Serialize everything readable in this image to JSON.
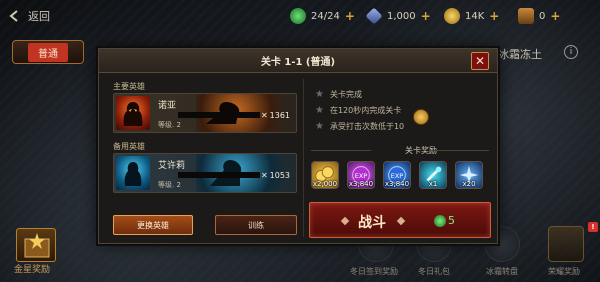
{
  "topbar": {
    "back_label": "返回",
    "resources": [
      {
        "icon": "green-potion-icon",
        "value": "24/24",
        "color": "#3fae4a"
      },
      {
        "icon": "blue-shard-icon",
        "value": "1,000",
        "color": "#6a86c8"
      },
      {
        "icon": "gold-coin-icon",
        "value": "14K",
        "color": "#d4a23c"
      },
      {
        "icon": "chest-icon",
        "value": "0",
        "color": "#b0783a"
      }
    ],
    "plus": "+"
  },
  "background": {
    "tab_label": "普通",
    "right_title": "冰霜冻土",
    "info": "i"
  },
  "dialog": {
    "title": "关卡 1-1 (普通)",
    "close": "✕",
    "main_hero_label": "主要英雄",
    "backup_hero_label": "备用英雄",
    "heroes": [
      {
        "name": "诺亚",
        "level": "等级. 2",
        "power": "1361"
      },
      {
        "name": "艾许莉",
        "level": "等级. 2",
        "power": "1053"
      }
    ],
    "swap_button": "更换英雄",
    "train_button": "训练",
    "objectives": [
      "关卡完成",
      "在120秒内完成关卡",
      "承受打击次数低于10"
    ],
    "reward_title": "关卡奖励",
    "rewards": [
      {
        "icon": "gold-coins-icon",
        "value": "x2,000"
      },
      {
        "icon": "exp-potion-purple-icon",
        "value": "x3,840"
      },
      {
        "icon": "exp-potion-blue-icon",
        "value": "x3,840"
      },
      {
        "icon": "skill-scroll-icon",
        "value": "x1"
      },
      {
        "icon": "frost-star-icon",
        "value": "x20"
      }
    ],
    "fight_label": "战斗",
    "fight_cost": "5"
  },
  "bottom": {
    "gold_star_reward": "金星奖励",
    "items": [
      "冬日签到奖励",
      "冬日礼包",
      "冰霜转盘",
      "荣耀奖励"
    ]
  }
}
